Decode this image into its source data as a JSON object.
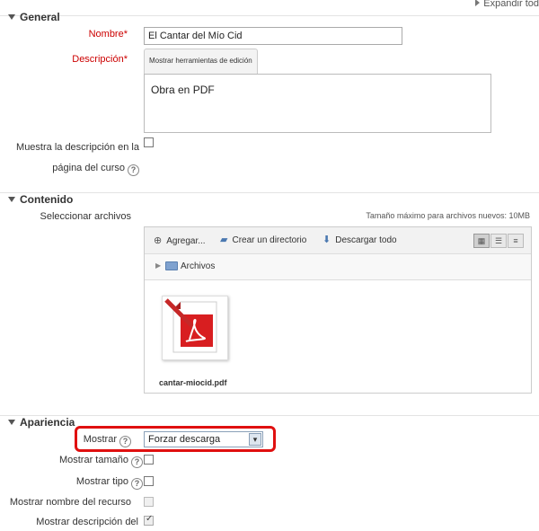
{
  "header": {
    "expand_all": "Expandir tod"
  },
  "sections": {
    "general": "General",
    "content": "Contenido",
    "appearance": "Apariencia"
  },
  "general": {
    "name_label": "Nombre",
    "name_value": "El Cantar del Mío Cid",
    "description_label": "Descripción",
    "editor_tools_tab": "Mostrar herramientas de edición",
    "description_text": "Obra en PDF",
    "show_desc_label_line1": "Muestra la descripción en la",
    "show_desc_label_line2": "página del curso",
    "required_mark": "*"
  },
  "content": {
    "select_files_label": "Seleccionar archivos",
    "max_size": "Tamaño máximo para archivos nuevos: 10MB",
    "toolbar": {
      "add": "Agregar...",
      "create_dir": "Crear un directorio",
      "download_all": "Descargar todo"
    },
    "path_folder": "Archivos",
    "files": [
      {
        "name": "cantar-miocid.pdf",
        "icon": "pdf-file-icon"
      }
    ]
  },
  "appearance": {
    "display_label": "Mostrar",
    "display_value": "Forzar descarga",
    "show_size_label": "Mostrar tamaño",
    "show_type_label": "Mostrar tipo",
    "show_resource_name_label": "Mostrar nombre del recurso",
    "show_description_label": "Mostrar descripción del"
  },
  "colors": {
    "required": "#cc0000",
    "highlight": "#e01010",
    "link_icon": "#4a78b0"
  }
}
